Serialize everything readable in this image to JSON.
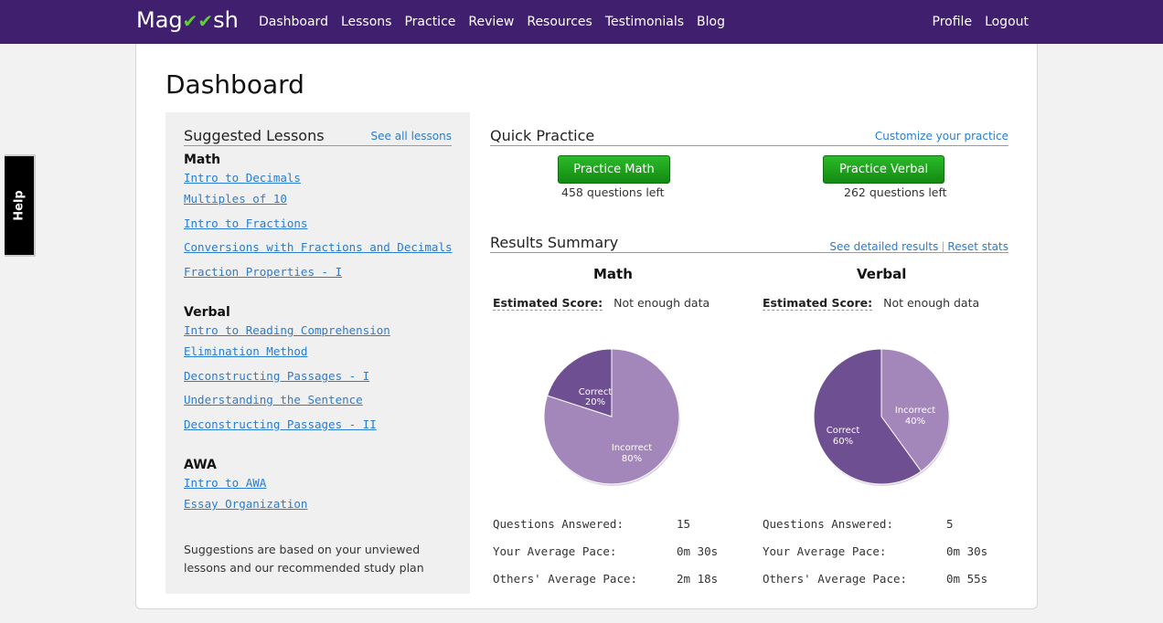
{
  "nav": {
    "logo_left": "Mag",
    "logo_right": "sh",
    "items": [
      "Dashboard",
      "Lessons",
      "Practice",
      "Review",
      "Resources",
      "Testimonials",
      "Blog"
    ],
    "right_items": [
      "Profile",
      "Logout"
    ]
  },
  "help": {
    "label": "Help"
  },
  "page_title": "Dashboard",
  "sidebar": {
    "title": "Suggested Lessons",
    "see_all": "See all lessons",
    "sections": [
      {
        "heading": "Math",
        "lessons": [
          "Intro to Decimals",
          "Multiples of 10",
          "Intro to Fractions",
          "Conversions with Fractions and Decimals",
          "Fraction Properties - I"
        ]
      },
      {
        "heading": "Verbal",
        "lessons": [
          "Intro to Reading Comprehension",
          "Elimination Method",
          "Deconstructing Passages - I",
          "Understanding the Sentence",
          "Deconstructing Passages - II"
        ]
      },
      {
        "heading": "AWA",
        "lessons": [
          "Intro to AWA",
          "Essay Organization"
        ]
      }
    ],
    "note": "Suggestions are based on your unviewed lessons and our recommended study plan"
  },
  "quick_practice": {
    "title": "Quick Practice",
    "customize": "Customize your practice",
    "math_button": "Practice Math",
    "math_left": "458 questions left",
    "verbal_button": "Practice Verbal",
    "verbal_left": "262 questions left"
  },
  "results": {
    "title": "Results Summary",
    "detailed": "See detailed results",
    "separator": "|",
    "reset": "Reset stats",
    "math": {
      "title": "Math",
      "est_label": "Estimated Score:",
      "est_value": "Not enough data",
      "correct_label": "Correct",
      "correct_pct": "20%",
      "incorrect_label": "Incorrect",
      "incorrect_pct": "80%",
      "stats": [
        {
          "label": "Questions Answered:",
          "value": "15"
        },
        {
          "label": "Your Average Pace:",
          "value": "0m 30s"
        },
        {
          "label": "Others' Average Pace:",
          "value": "2m 18s"
        }
      ]
    },
    "verbal": {
      "title": "Verbal",
      "est_label": "Estimated Score:",
      "est_value": "Not enough data",
      "correct_label": "Correct",
      "correct_pct": "60%",
      "incorrect_label": "Incorrect",
      "incorrect_pct": "40%",
      "stats": [
        {
          "label": "Questions Answered:",
          "value": "5"
        },
        {
          "label": "Your Average Pace:",
          "value": "0m 30s"
        },
        {
          "label": "Others' Average Pace:",
          "value": "0m 55s"
        }
      ]
    }
  },
  "colors": {
    "nav_bg": "#3f1f6e",
    "correct": "#6e4f92",
    "incorrect": "#a487ba",
    "button": "#1aa019",
    "link": "#2a7ccf"
  },
  "icons": {
    "logo_check": "check-icon"
  }
}
